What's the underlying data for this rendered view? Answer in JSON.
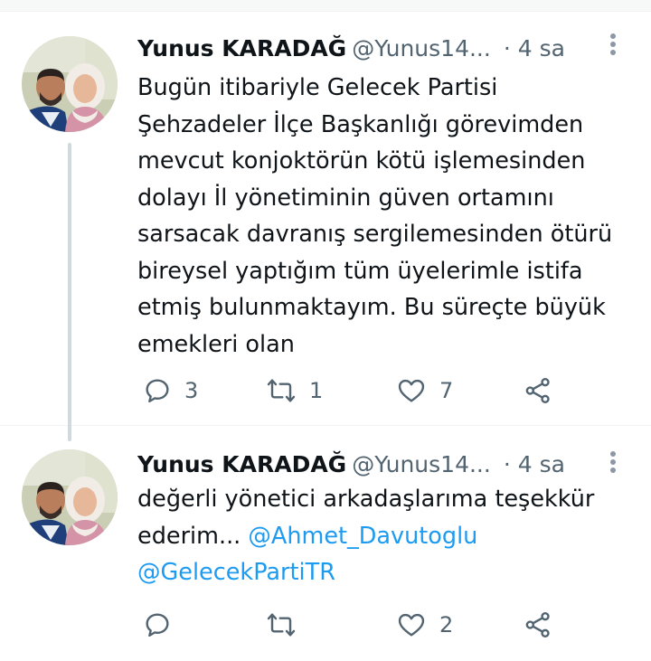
{
  "tweets": [
    {
      "author_name": "Yunus KARADAĞ",
      "author_handle": "@Yunus14...",
      "separator": "·",
      "time": "4 sa",
      "avatar_icon": "profile-photo-avatar",
      "text_lines": [
        "Bugün itibariyle Gelecek Partisi",
        "Şehzadeler İlçe Başkanlığı görevimden",
        "mevcut konjoktörün kötü işlemesinden",
        "dolayı İl yönetiminin güven ortamını",
        "sarsacak davranış sergilemesinden ötürü",
        "bireysel yaptığım tüm üyelerimle istifa",
        "etmiş bulunmaktayım. Bu süreçte büyük",
        "emekleri olan"
      ],
      "reply_count": "3",
      "retweet_count": "1",
      "like_count": "7"
    },
    {
      "author_name": "Yunus KARADAĞ",
      "author_handle": "@Yunus14...",
      "separator": "·",
      "time": "4 sa",
      "avatar_icon": "profile-photo-avatar",
      "text_lines": [
        "değerli yönetici arkadaşlarıma teşekkür",
        "ederim...",
        "@Ahmet_Davutoglu",
        "@GelecekPartiTR"
      ],
      "reply_count": "",
      "retweet_count": "",
      "like_count": "2"
    }
  ],
  "icons": {
    "reply": "reply-bubble-icon",
    "retweet": "retweet-icon",
    "like": "heart-icon",
    "share": "share-icon",
    "more": "more-vertical-icon"
  },
  "colors": {
    "text": "#0f1419",
    "secondary": "#536471",
    "link": "#1d9bf0",
    "thread_line": "#cfd9de",
    "divider": "#eff3f4"
  }
}
